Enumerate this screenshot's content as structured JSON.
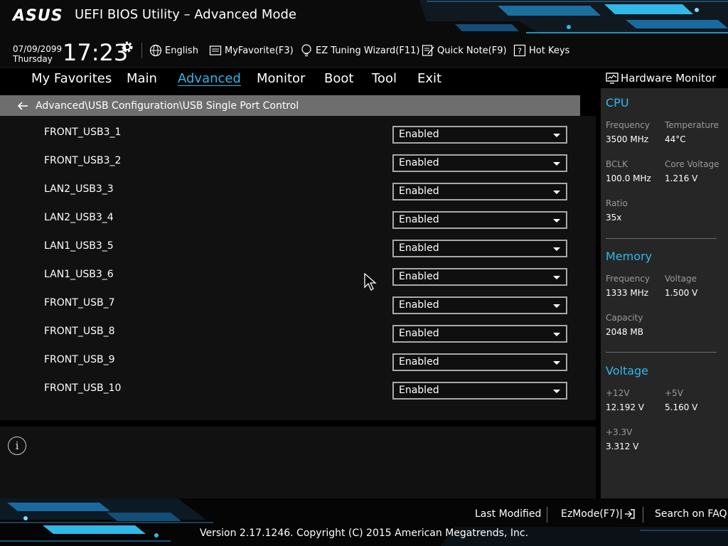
{
  "header": {
    "logo_text": "ASUS",
    "title": "UEFI BIOS Utility – Advanced Mode",
    "date": "07/09/2099",
    "day": "Thursday",
    "time": "17:23",
    "toolbar": [
      {
        "label": "English",
        "icon": "globe-icon"
      },
      {
        "label": "MyFavorite(F3)",
        "icon": "favorite-icon"
      },
      {
        "label": "EZ Tuning Wizard(F11)",
        "icon": "lightbulb-icon"
      },
      {
        "label": "Quick Note(F9)",
        "icon": "note-icon"
      },
      {
        "label": "Hot Keys",
        "icon": "question-icon"
      }
    ]
  },
  "nav": {
    "tabs": [
      "My Favorites",
      "Main",
      "Advanced",
      "Monitor",
      "Boot",
      "Tool",
      "Exit"
    ],
    "active": "Advanced"
  },
  "breadcrumb": "Advanced\\USB Configuration\\USB Single Port Control",
  "settings": [
    {
      "label": "FRONT_USB3_1",
      "value": "Enabled"
    },
    {
      "label": "FRONT_USB3_2",
      "value": "Enabled"
    },
    {
      "label": "LAN2_USB3_3",
      "value": "Enabled"
    },
    {
      "label": "LAN2_USB3_4",
      "value": "Enabled"
    },
    {
      "label": "LAN1_USB3_5",
      "value": "Enabled"
    },
    {
      "label": "LAN1_USB3_6",
      "value": "Enabled"
    },
    {
      "label": "FRONT_USB_7",
      "value": "Enabled"
    },
    {
      "label": "FRONT_USB_8",
      "value": "Enabled"
    },
    {
      "label": "FRONT_USB_9",
      "value": "Enabled"
    },
    {
      "label": "FRONT_USB_10",
      "value": "Enabled"
    }
  ],
  "info_icon_text": "i",
  "hardware_monitor": {
    "title": "Hardware Monitor",
    "cpu": {
      "title": "CPU",
      "frequency_label": "Frequency",
      "frequency": "3500 MHz",
      "temperature_label": "Temperature",
      "temperature": "44°C",
      "bclk_label": "BCLK",
      "bclk": "100.0 MHz",
      "core_voltage_label": "Core Voltage",
      "core_voltage": "1.216 V",
      "ratio_label": "Ratio",
      "ratio": "35x"
    },
    "memory": {
      "title": "Memory",
      "frequency_label": "Frequency",
      "frequency": "1333 MHz",
      "voltage_label": "Voltage",
      "voltage": "1.500 V",
      "capacity_label": "Capacity",
      "capacity": "2048 MB"
    },
    "voltage": {
      "title": "Voltage",
      "v12_label": "+12V",
      "v12": "12.192 V",
      "v5_label": "+5V",
      "v5": "5.160 V",
      "v33_label": "+3.3V",
      "v33": "3.312 V"
    }
  },
  "footer": {
    "last_modified": "Last Modified",
    "ez_mode": "EzMode(F7)|",
    "search_faq": "Search on FAQ",
    "copyright": "Version 2.17.1246. Copyright (C) 2015 American Megatrends, Inc."
  },
  "colors": {
    "accent": "#2fb8e8",
    "breadcrumb_bg": "#6e6e6e",
    "panel_bg": "#111111",
    "monitor_bg": "#262626"
  }
}
